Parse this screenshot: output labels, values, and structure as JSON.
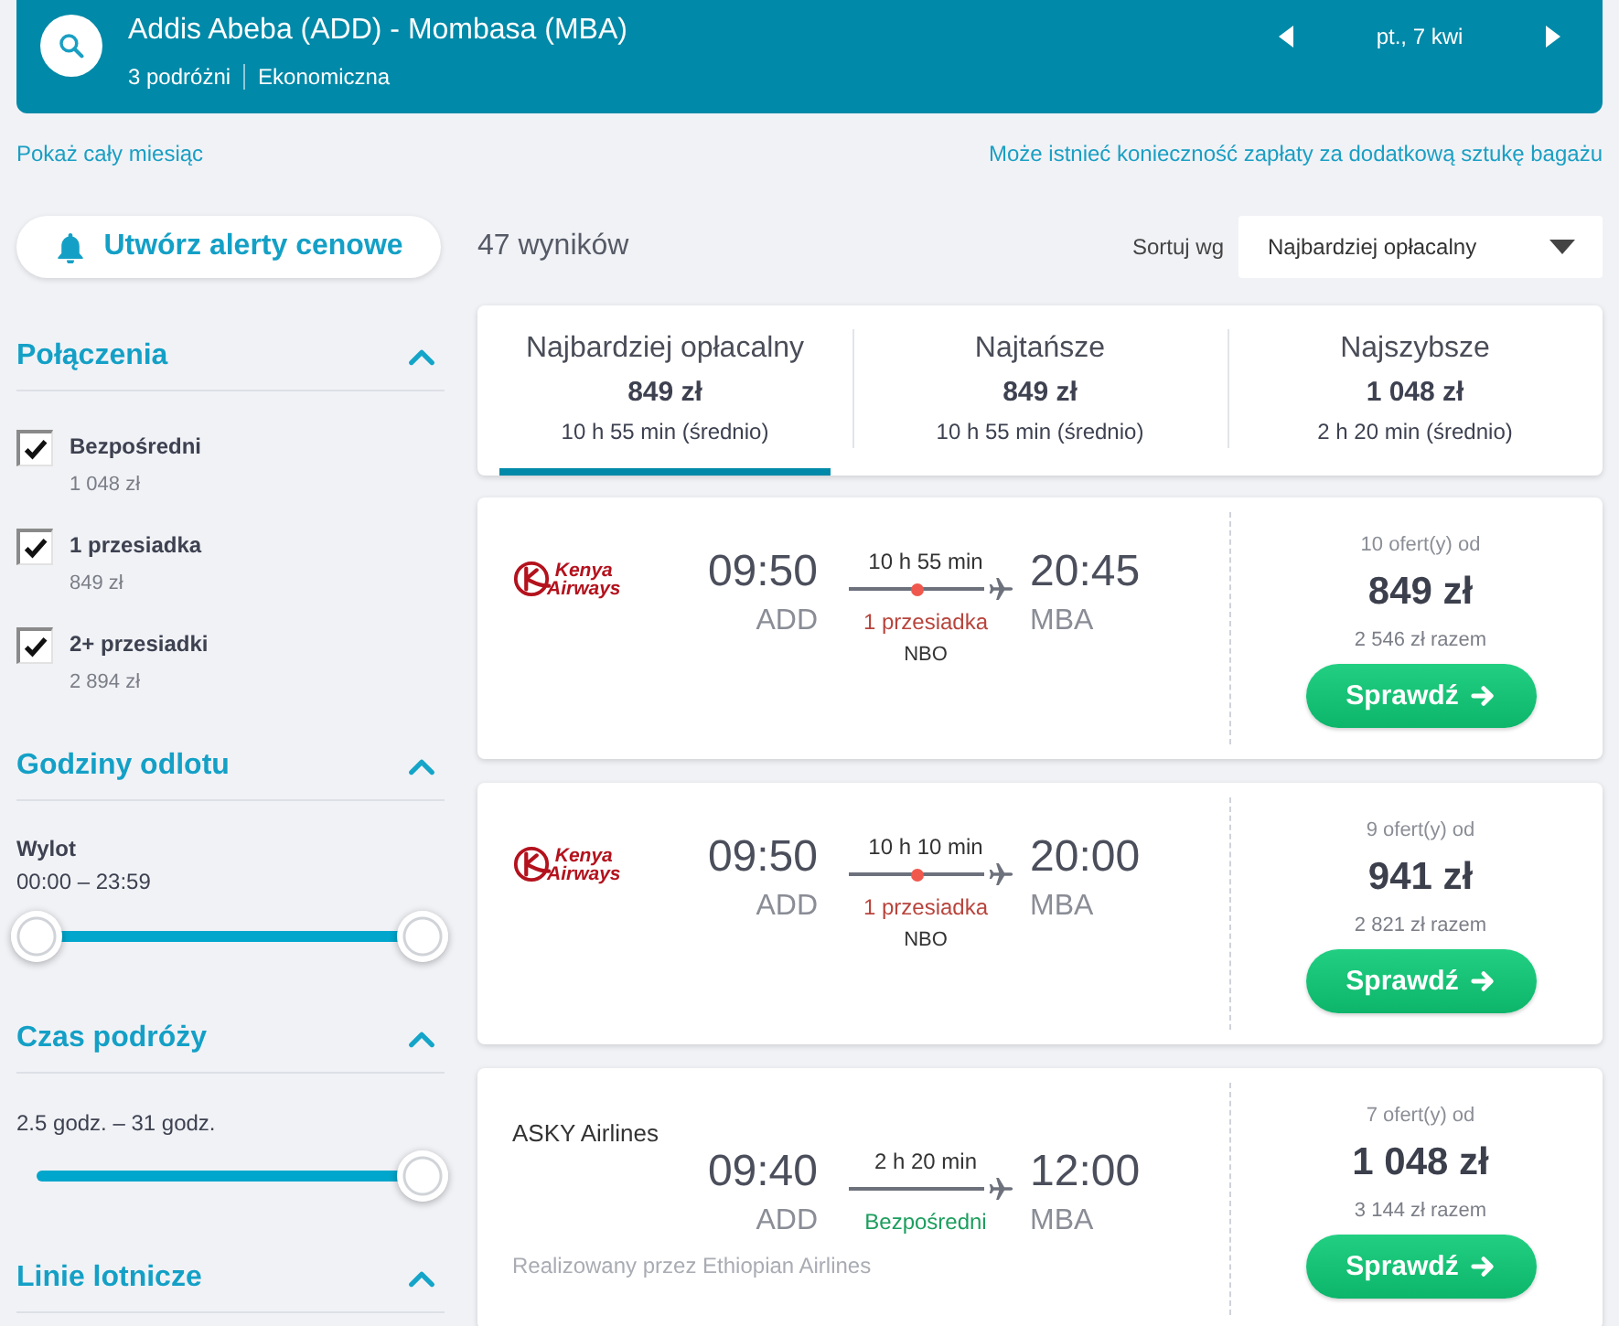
{
  "header": {
    "title": "Addis Abeba (ADD) - Mombasa (MBA)",
    "travellers": "3 podróżni",
    "cabin": "Ekonomiczna",
    "date": "pt., 7 kwi"
  },
  "links": {
    "month": "Pokaż cały miesiąc",
    "baggage_note": "Może istnieć konieczność zapłaty za dodatkową sztukę bagażu"
  },
  "sidebar": {
    "alert_button": "Utwórz alerty cenowe",
    "sections": [
      {
        "kind": "checkboxes",
        "title": "Połączenia",
        "expanded": true,
        "options": [
          {
            "label": "Bezpośredni",
            "price": "1 048 zł",
            "checked": true
          },
          {
            "label": "1 przesiadka",
            "price": "849 zł",
            "checked": true
          },
          {
            "label": "2+ przesiadki",
            "price": "2 894 zł",
            "checked": true
          }
        ]
      },
      {
        "kind": "slider",
        "title": "Godziny odlotu",
        "expanded": true,
        "label": "Wylot",
        "range": "00:00 – 23:59",
        "thumbs": [
          {
            "level": 0
          },
          {
            "level": 1
          }
        ]
      },
      {
        "kind": "slider",
        "title": "Czas podróży",
        "expanded": true,
        "range": "2.5 godz. – 31 godz.",
        "thumbs": [
          {
            "level": 1
          }
        ]
      },
      {
        "kind": "collapsible",
        "title": "Linie lotnicze",
        "expanded": true
      }
    ]
  },
  "results": {
    "count": "47 wyników",
    "sort_label": "Sortuj wg",
    "sort_value": "Najbardziej opłacalny",
    "tabs": [
      {
        "label": "Najbardziej opłacalny",
        "price": "849 zł",
        "duration": "10 h 55 min (średnio)",
        "selected": true
      },
      {
        "label": "Najtańsze",
        "price": "849 zł",
        "duration": "10 h 55 min (średnio)",
        "selected": false
      },
      {
        "label": "Najszybsze",
        "price": "1 048 zł",
        "duration": "2 h 20 min (średnio)",
        "selected": false
      }
    ],
    "flights": [
      {
        "carrier": {
          "kind": "logo",
          "name": "Kenya Airways"
        },
        "departure": "09:50",
        "from": "ADD",
        "duration": "10 h 55 min",
        "kind": "stopover",
        "stops": "1 przesiadka",
        "via": "NBO",
        "arrival": "20:45",
        "to": "MBA",
        "offers": "10 ofert(y) od",
        "price": "849 zł",
        "total": "2 546 zł razem",
        "button": "Sprawdź"
      },
      {
        "carrier": {
          "kind": "logo",
          "name": "Kenya Airways"
        },
        "departure": "09:50",
        "from": "ADD",
        "duration": "10 h 10 min",
        "kind": "stopover",
        "stops": "1 przesiadka",
        "via": "NBO",
        "arrival": "20:00",
        "to": "MBA",
        "offers": "9 ofert(y) od",
        "price": "941 zł",
        "total": "2 821 zł razem",
        "button": "Sprawdź"
      },
      {
        "carrier": {
          "kind": "text",
          "name": "ASKY Airlines"
        },
        "departure": "09:40",
        "from": "ADD",
        "duration": "2 h 20 min",
        "kind": "direct",
        "stops": "Bezpośredni",
        "arrival": "12:00",
        "to": "MBA",
        "operated_by": "Realizowany przez Ethiopian Airlines",
        "offers": "7 ofert(y) od",
        "price": "1 048 zł",
        "total": "3 144 zł razem",
        "button": "Sprawdź"
      }
    ]
  }
}
